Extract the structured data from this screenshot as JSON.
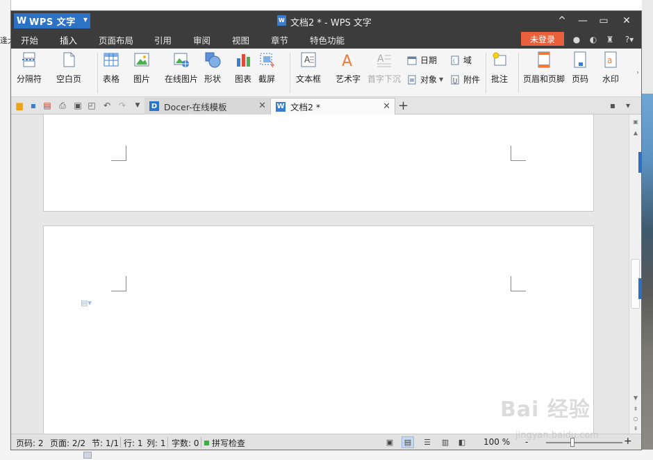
{
  "desktop": {
    "left_edge_text": "逢大"
  },
  "titlebar": {
    "app_menu_label": "WPS 文字",
    "app_menu_icon": "W",
    "doc_title": "文档2 * - WPS 文字",
    "controls": {
      "collapse": "^",
      "minimize": "—",
      "maximize": "▭",
      "close": "✕"
    }
  },
  "menu": {
    "tabs": [
      "开始",
      "插入",
      "页面布局",
      "引用",
      "审阅",
      "视图",
      "章节",
      "特色功能"
    ],
    "active_tab": "插入",
    "login_label": "未登录",
    "help_label": "?"
  },
  "ribbon": {
    "section_break": "分隔符",
    "blank_page": "空白页",
    "table": "表格",
    "picture": "图片",
    "online_picture": "在线图片",
    "shapes": "形状",
    "chart": "图表",
    "screenshot": "截屏",
    "textbox": "文本框",
    "wordart": "艺术字",
    "drop_cap": "首字下沉",
    "date": "日期",
    "field": "域",
    "object": "对象",
    "attachment": "附件",
    "comment": "批注",
    "header_footer": "页眉和页脚",
    "page_number": "页码",
    "watermark": "水印"
  },
  "tabbar": {
    "tabs": [
      {
        "label": "Docer-在线模板",
        "icon": "D"
      },
      {
        "label": "文档2 *",
        "icon": "W"
      }
    ],
    "new_tab_label": "+"
  },
  "statusbar": {
    "page_code": "页码: 2",
    "pages": "页面: 2/2",
    "section": "节: 1/1",
    "line": "行: 1",
    "column": "列: 1",
    "word_count": "字数: 0",
    "spell_check": "拼写检查",
    "zoom": "100 %",
    "zoom_minus": "-",
    "zoom_plus": "+"
  },
  "watermark_overlay": {
    "brand": "Bai 经验",
    "url": "jingyan.baidu.com"
  },
  "colors": {
    "titlebar_bg": "#3c3c3c",
    "app_button": "#2c73c6",
    "login_button": "#e8613c",
    "ribbon_bg": "#f5f5f5",
    "doc_bg": "#e7e7e7"
  }
}
